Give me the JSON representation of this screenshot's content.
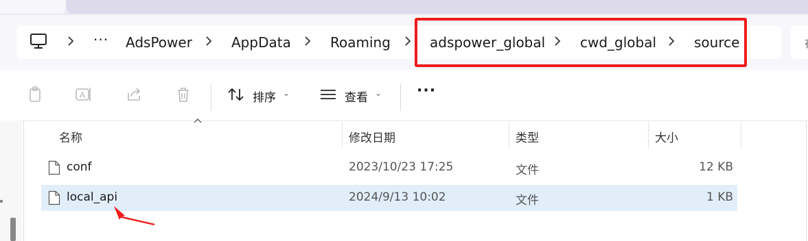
{
  "tabs": {
    "close_glyph": "✕",
    "add_glyph": "+"
  },
  "address_bar": {
    "more_glyph": "···",
    "crumbs": [
      "AdsPower",
      "AppData",
      "Roaming",
      "adspower_global",
      "cwd_global",
      "source"
    ],
    "search_stub_glyph": "在",
    "highlight_color": "#ef1c1c"
  },
  "command_bar": {
    "sort_label": "排序",
    "view_label": "查看",
    "more_glyph": "···",
    "icons": [
      "copy-icon",
      "rename-icon",
      "share-icon",
      "delete-icon",
      "sort-icon",
      "view-icon"
    ]
  },
  "columns": {
    "name": "名称",
    "modified": "修改日期",
    "type": "类型",
    "size": "大小"
  },
  "files": [
    {
      "name": "conf",
      "modified": "2023/10/23 17:25",
      "type": "文件",
      "size": "12 KB",
      "selected": false
    },
    {
      "name": "local_api",
      "modified": "2024/9/13 10:02",
      "type": "文件",
      "size": "1 KB",
      "selected": true
    }
  ],
  "colors": {
    "selection": "#e1eefa",
    "annotation": "#ef1c1c",
    "tab_strip": "#ece8f5"
  }
}
